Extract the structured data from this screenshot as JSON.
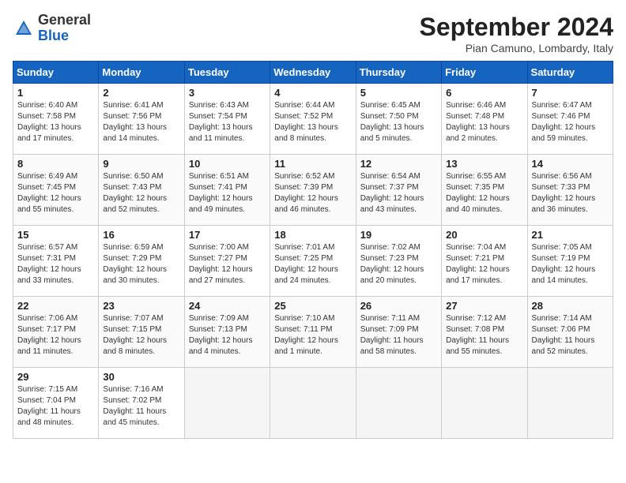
{
  "header": {
    "logo": {
      "line1": "General",
      "line2": "Blue"
    },
    "title": "September 2024",
    "location": "Pian Camuno, Lombardy, Italy"
  },
  "weekdays": [
    "Sunday",
    "Monday",
    "Tuesday",
    "Wednesday",
    "Thursday",
    "Friday",
    "Saturday"
  ],
  "weeks": [
    [
      {
        "day": "1",
        "detail": "Sunrise: 6:40 AM\nSunset: 7:58 PM\nDaylight: 13 hours\nand 17 minutes."
      },
      {
        "day": "2",
        "detail": "Sunrise: 6:41 AM\nSunset: 7:56 PM\nDaylight: 13 hours\nand 14 minutes."
      },
      {
        "day": "3",
        "detail": "Sunrise: 6:43 AM\nSunset: 7:54 PM\nDaylight: 13 hours\nand 11 minutes."
      },
      {
        "day": "4",
        "detail": "Sunrise: 6:44 AM\nSunset: 7:52 PM\nDaylight: 13 hours\nand 8 minutes."
      },
      {
        "day": "5",
        "detail": "Sunrise: 6:45 AM\nSunset: 7:50 PM\nDaylight: 13 hours\nand 5 minutes."
      },
      {
        "day": "6",
        "detail": "Sunrise: 6:46 AM\nSunset: 7:48 PM\nDaylight: 13 hours\nand 2 minutes."
      },
      {
        "day": "7",
        "detail": "Sunrise: 6:47 AM\nSunset: 7:46 PM\nDaylight: 12 hours\nand 59 minutes."
      }
    ],
    [
      {
        "day": "8",
        "detail": "Sunrise: 6:49 AM\nSunset: 7:45 PM\nDaylight: 12 hours\nand 55 minutes."
      },
      {
        "day": "9",
        "detail": "Sunrise: 6:50 AM\nSunset: 7:43 PM\nDaylight: 12 hours\nand 52 minutes."
      },
      {
        "day": "10",
        "detail": "Sunrise: 6:51 AM\nSunset: 7:41 PM\nDaylight: 12 hours\nand 49 minutes."
      },
      {
        "day": "11",
        "detail": "Sunrise: 6:52 AM\nSunset: 7:39 PM\nDaylight: 12 hours\nand 46 minutes."
      },
      {
        "day": "12",
        "detail": "Sunrise: 6:54 AM\nSunset: 7:37 PM\nDaylight: 12 hours\nand 43 minutes."
      },
      {
        "day": "13",
        "detail": "Sunrise: 6:55 AM\nSunset: 7:35 PM\nDaylight: 12 hours\nand 40 minutes."
      },
      {
        "day": "14",
        "detail": "Sunrise: 6:56 AM\nSunset: 7:33 PM\nDaylight: 12 hours\nand 36 minutes."
      }
    ],
    [
      {
        "day": "15",
        "detail": "Sunrise: 6:57 AM\nSunset: 7:31 PM\nDaylight: 12 hours\nand 33 minutes."
      },
      {
        "day": "16",
        "detail": "Sunrise: 6:59 AM\nSunset: 7:29 PM\nDaylight: 12 hours\nand 30 minutes."
      },
      {
        "day": "17",
        "detail": "Sunrise: 7:00 AM\nSunset: 7:27 PM\nDaylight: 12 hours\nand 27 minutes."
      },
      {
        "day": "18",
        "detail": "Sunrise: 7:01 AM\nSunset: 7:25 PM\nDaylight: 12 hours\nand 24 minutes."
      },
      {
        "day": "19",
        "detail": "Sunrise: 7:02 AM\nSunset: 7:23 PM\nDaylight: 12 hours\nand 20 minutes."
      },
      {
        "day": "20",
        "detail": "Sunrise: 7:04 AM\nSunset: 7:21 PM\nDaylight: 12 hours\nand 17 minutes."
      },
      {
        "day": "21",
        "detail": "Sunrise: 7:05 AM\nSunset: 7:19 PM\nDaylight: 12 hours\nand 14 minutes."
      }
    ],
    [
      {
        "day": "22",
        "detail": "Sunrise: 7:06 AM\nSunset: 7:17 PM\nDaylight: 12 hours\nand 11 minutes."
      },
      {
        "day": "23",
        "detail": "Sunrise: 7:07 AM\nSunset: 7:15 PM\nDaylight: 12 hours\nand 8 minutes."
      },
      {
        "day": "24",
        "detail": "Sunrise: 7:09 AM\nSunset: 7:13 PM\nDaylight: 12 hours\nand 4 minutes."
      },
      {
        "day": "25",
        "detail": "Sunrise: 7:10 AM\nSunset: 7:11 PM\nDaylight: 12 hours\nand 1 minute."
      },
      {
        "day": "26",
        "detail": "Sunrise: 7:11 AM\nSunset: 7:09 PM\nDaylight: 11 hours\nand 58 minutes."
      },
      {
        "day": "27",
        "detail": "Sunrise: 7:12 AM\nSunset: 7:08 PM\nDaylight: 11 hours\nand 55 minutes."
      },
      {
        "day": "28",
        "detail": "Sunrise: 7:14 AM\nSunset: 7:06 PM\nDaylight: 11 hours\nand 52 minutes."
      }
    ],
    [
      {
        "day": "29",
        "detail": "Sunrise: 7:15 AM\nSunset: 7:04 PM\nDaylight: 11 hours\nand 48 minutes."
      },
      {
        "day": "30",
        "detail": "Sunrise: 7:16 AM\nSunset: 7:02 PM\nDaylight: 11 hours\nand 45 minutes."
      },
      {
        "day": "",
        "detail": ""
      },
      {
        "day": "",
        "detail": ""
      },
      {
        "day": "",
        "detail": ""
      },
      {
        "day": "",
        "detail": ""
      },
      {
        "day": "",
        "detail": ""
      }
    ]
  ]
}
